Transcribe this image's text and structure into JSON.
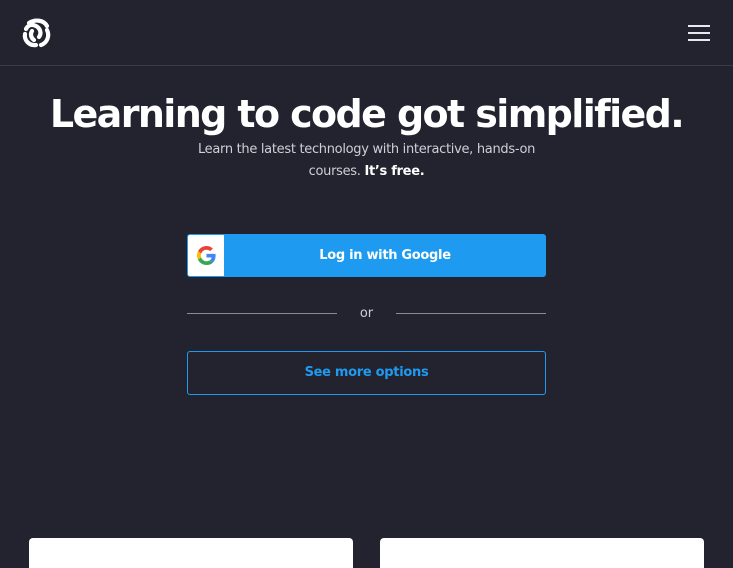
{
  "navbar": {
    "logo_icon": "sololearn-logo-icon",
    "menu_icon": "hamburger-menu-icon"
  },
  "hero": {
    "title": "Learning to code got simplified.",
    "subtitle": "Learn the latest technology with interactive, hands-on courses.",
    "subtitle_emphasis": "It’s free."
  },
  "auth": {
    "google_button_label": "Log in with Google",
    "google_icon": "google-g-icon",
    "divider_text": "or",
    "more_options_label": "See more options"
  },
  "colors": {
    "background": "#232330",
    "accent": "#1e9bf0",
    "text": "#ffffff"
  }
}
